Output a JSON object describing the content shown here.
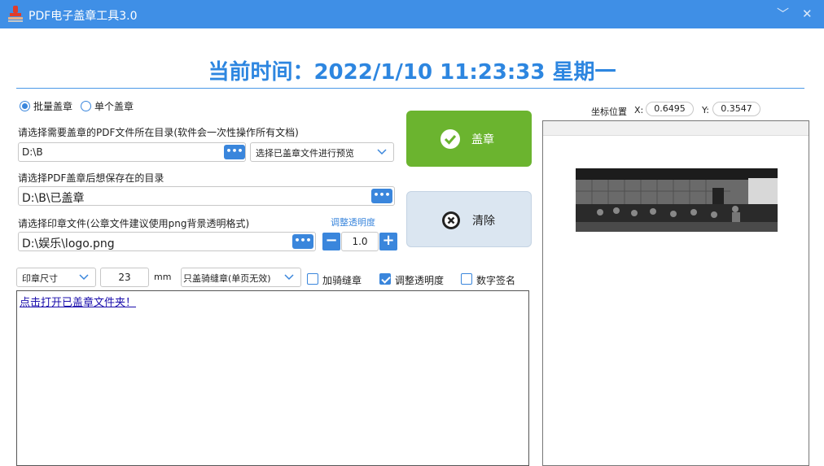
{
  "window": {
    "title": "PDF电子盖章工具3.0",
    "minimize_glyph": "﹀",
    "close_glyph": "✕"
  },
  "clock": {
    "text": "当前时间：2022/1/10 11:23:33  星期一"
  },
  "mode": {
    "batch_label": "批量盖章",
    "single_label": "单个盖章",
    "selected": "batch"
  },
  "source_dir": {
    "label": "请选择需要盖章的PDF文件所在目录(软件会一次性操作所有文档)",
    "value": "D:\\B",
    "browse_glyph": "•••",
    "preview_select": "选择已盖章文件进行预览"
  },
  "output_dir": {
    "label": "请选择PDF盖章后想保存在的目录",
    "value": "D:\\B\\已盖章",
    "browse_glyph": "•••"
  },
  "stamp_file": {
    "label": "请选择印章文件(公章文件建议使用png背景透明格式)",
    "value": "D:\\娱乐\\logo.png",
    "browse_glyph": "•••",
    "opacity_link": "调整透明度",
    "opacity_value": "1.0",
    "minus": "−",
    "plus": "+"
  },
  "actions": {
    "stamp_label": "盖章",
    "clear_label": "清除",
    "stamp_color": "#6bb42f",
    "clear_color": "#dbe6f1"
  },
  "options": {
    "size_select": "印章尺寸",
    "size_value": "23",
    "size_unit": "mm",
    "seam_select": "只盖骑缝章(单页无效)",
    "seam_label": "加骑缝章",
    "seam_checked": false,
    "opacity_label": "调整透明度",
    "opacity_checked": true,
    "signature_label": "数字签名",
    "signature_checked": false
  },
  "log": {
    "open_folder_link": "点击打开已盖章文件夹！"
  },
  "coords": {
    "label": "坐标位置",
    "x_label": "X:",
    "x_value": "0.6495",
    "y_label": "Y:",
    "y_value": "0.3547"
  },
  "colors": {
    "titlebar": "#3f8fe6",
    "accent": "#3a86dc",
    "clock": "#2d86e0"
  }
}
